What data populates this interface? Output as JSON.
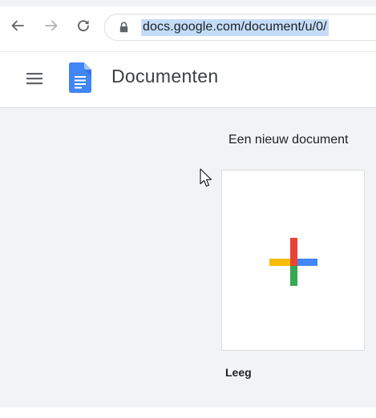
{
  "browser": {
    "url": "docs.google.com/document/u/0/",
    "back_icon": "arrow-left-icon",
    "forward_icon": "arrow-right-icon",
    "reload_icon": "reload-icon",
    "lock_icon": "lock-icon"
  },
  "header": {
    "menu_icon": "hamburger-menu-icon",
    "logo_icon": "google-docs-logo-icon",
    "title": "Documenten"
  },
  "gallery": {
    "heading": "Een nieuw document",
    "templates": [
      {
        "label": "Leeg",
        "icon": "colored-plus-icon"
      }
    ]
  },
  "colors": {
    "gallery_background": "#f1f3f4",
    "docs_blue": "#4285f4",
    "plus_red": "#ea4335",
    "plus_yellow": "#fbbc04",
    "plus_green": "#34a853",
    "plus_blue": "#4285f4",
    "url_highlight": "#c4dcf8"
  }
}
